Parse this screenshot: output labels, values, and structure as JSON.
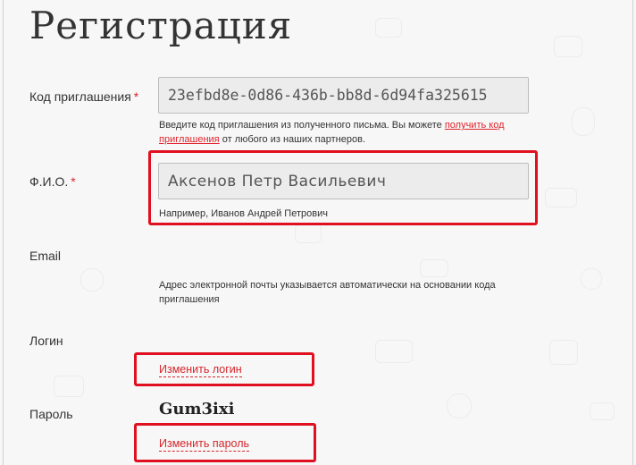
{
  "page": {
    "title": "Регистрация"
  },
  "invite": {
    "label": "Код приглашения",
    "required_mark": "*",
    "value": "23efbd8e-0d86-436b-bb8d-6d94fa325615",
    "hint_before": "Введите код приглашения из полученного письма. Вы можете",
    "hint_link": "получить код приглашения",
    "hint_after": "от любого из наших партнеров."
  },
  "fio": {
    "label": "Ф.И.О.",
    "required_mark": "*",
    "value": "Аксенов Петр Васильевич",
    "hint": "Например, Иванов Андрей Петрович"
  },
  "email": {
    "label": "Email",
    "hint": "Адрес электронной почты указывается автоматически на основании кода приглашения"
  },
  "login": {
    "label": "Логин",
    "change_link": "Изменить логин"
  },
  "password": {
    "label": "Пароль",
    "value": "Gum3ixi",
    "change_link": "Изменить пароль"
  },
  "colors": {
    "accent": "#e0242c",
    "highlight_box": "#e01020"
  }
}
